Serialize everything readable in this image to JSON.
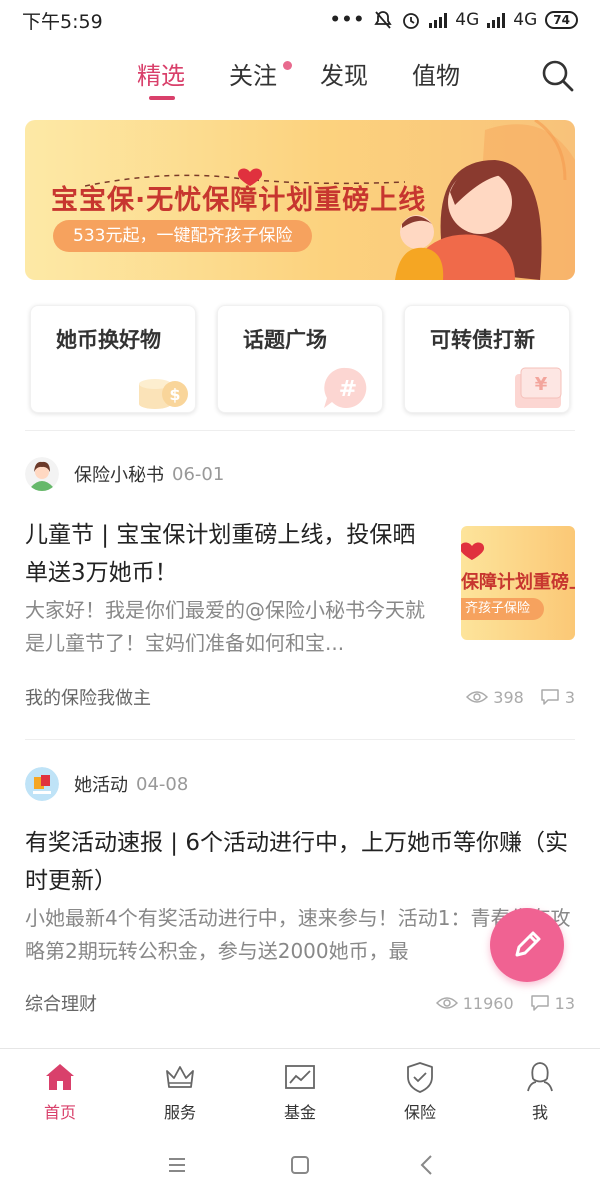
{
  "status_bar": {
    "time": "下午5:59",
    "network1": "4G",
    "network2": "4G",
    "battery": "74"
  },
  "top_nav": {
    "tabs": [
      {
        "label": "精选",
        "active": true
      },
      {
        "label": "关注",
        "has_dot": true
      },
      {
        "label": "发现"
      },
      {
        "label": "值物"
      }
    ]
  },
  "banner": {
    "title": "宝宝保·无忧保障计划重磅上线",
    "subtitle": "533元起，一键配齐孩子保险"
  },
  "shortcuts": [
    {
      "label": "她币换好物",
      "icon": "coin-icon"
    },
    {
      "label": "话题广场",
      "icon": "hashtag-icon"
    },
    {
      "label": "可转债打新",
      "icon": "yen-ticket-icon"
    }
  ],
  "posts": [
    {
      "author": "保险小秘书",
      "date": "06-01",
      "title": "儿童节 | 宝宝保计划重磅上线，投保晒单送3万她币！",
      "excerpt": "大家好！我是你们最爱的@保险小秘书今天就是儿童节了！宝妈们准备如何和宝...",
      "thumb_line1": "保障计划重磅上",
      "thumb_line2": "齐孩子保险",
      "tag": "我的保险我做主",
      "views": "398",
      "comments": "3"
    },
    {
      "author": "她活动",
      "date": "04-08",
      "title": "有奖活动速报 | 6个活动进行中，上万她币等你赚（实时更新）",
      "excerpt": "小她最新4个有奖活动进行中，速来参与！活动1：青春生存攻略第2期玩转公积金，参与送2000她币，最",
      "tag": "综合理财",
      "views": "11960",
      "comments": "13"
    }
  ],
  "bottom_nav": [
    {
      "label": "首页",
      "icon": "home-icon",
      "active": true
    },
    {
      "label": "服务",
      "icon": "crown-icon"
    },
    {
      "label": "基金",
      "icon": "chart-icon"
    },
    {
      "label": "保险",
      "icon": "shield-icon"
    },
    {
      "label": "我",
      "icon": "user-icon"
    }
  ],
  "colors": {
    "accent": "#d9406b",
    "fab": "#f06292",
    "banner_text": "#c7362f"
  }
}
